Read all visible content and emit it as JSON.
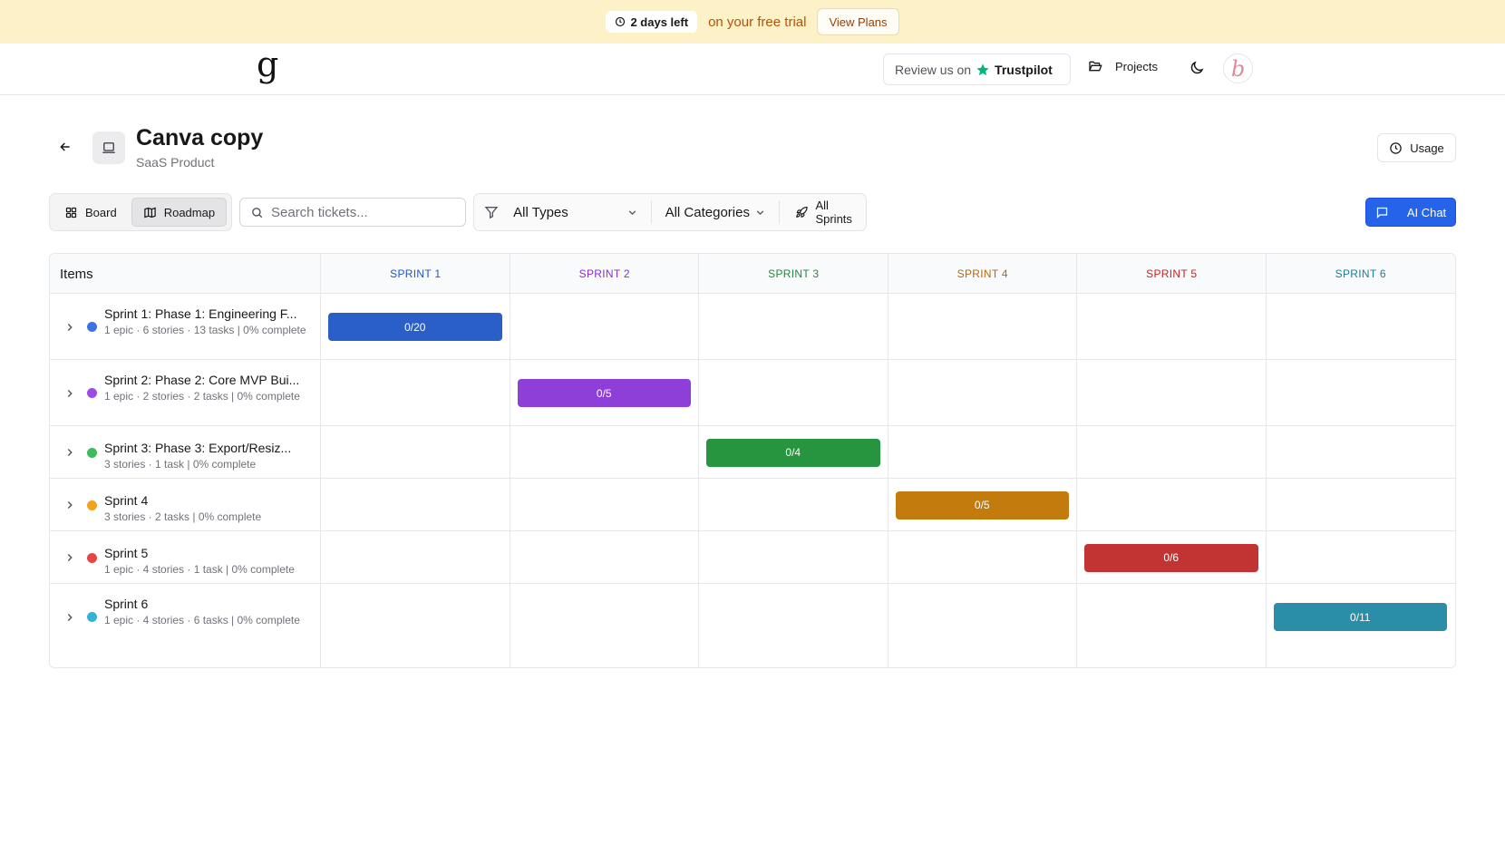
{
  "banner": {
    "days_left": "2 days left",
    "trial_text": "on your free trial",
    "view_plans": "View Plans"
  },
  "header": {
    "logo": "g",
    "review_prefix": "Review us on",
    "review_brand": "Trustpilot",
    "projects": "Projects",
    "avatar_letter": "b"
  },
  "project": {
    "title": "Canva copy",
    "subtitle": "SaaS Product",
    "usage": "Usage"
  },
  "toolbar": {
    "board": "Board",
    "roadmap": "Roadmap",
    "search_placeholder": "Search tickets...",
    "types": "All Types",
    "categories": "All Categories",
    "sprints": "All Sprints",
    "ai_chat": "AI Chat"
  },
  "roadmap": {
    "items_header": "Items",
    "columns": [
      {
        "label": "SPRINT 1",
        "color": "#2355c4"
      },
      {
        "label": "SPRINT 2",
        "color": "#8b2fd1"
      },
      {
        "label": "SPRINT 3",
        "color": "#1e8a3e"
      },
      {
        "label": "SPRINT 4",
        "color": "#b8680c"
      },
      {
        "label": "SPRINT 5",
        "color": "#c42424"
      },
      {
        "label": "SPRINT 6",
        "color": "#1b7d98"
      }
    ],
    "rows": [
      {
        "title": "Sprint 1: Phase 1: Engineering F...",
        "meta": "1 epic · 6 stories · 13 tasks | 0% complete",
        "dot": "#3b73e0",
        "bar_label": "0/20",
        "bar_color": "#2a5fc8"
      },
      {
        "title": "Sprint 2: Phase 2: Core MVP Bui...",
        "meta": "1 epic · 2 stories · 2 tasks | 0% complete",
        "dot": "#9b4be6",
        "bar_label": "0/5",
        "bar_color": "#8e3fd8"
      },
      {
        "title": "Sprint 3: Phase 3: Export/Resiz...",
        "meta": "3 stories · 1 task | 0% complete",
        "dot": "#3dbb5e",
        "bar_label": "0/4",
        "bar_color": "#27943f"
      },
      {
        "title": "Sprint 4",
        "meta": "3 stories · 2 tasks | 0% complete",
        "dot": "#f2a21c",
        "bar_label": "0/5",
        "bar_color": "#c27b0c"
      },
      {
        "title": "Sprint 5",
        "meta": "1 epic · 4 stories · 1 task | 0% complete",
        "dot": "#e54646",
        "bar_label": "0/6",
        "bar_color": "#c23434"
      },
      {
        "title": "Sprint 6",
        "meta": "1 epic · 4 stories · 6 tasks | 0% complete",
        "dot": "#33b2d3",
        "bar_label": "0/11",
        "bar_color": "#2a8ea8"
      }
    ]
  }
}
